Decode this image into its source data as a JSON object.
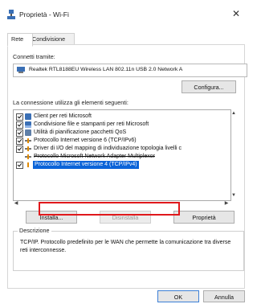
{
  "window": {
    "title": "Proprietà - Wi-Fi",
    "close_glyph": "✕"
  },
  "tabs": [
    {
      "label": "Rete",
      "active": true
    },
    {
      "label": "Condivisione",
      "active": false
    }
  ],
  "connect_label": "Connetti tramite:",
  "adapter": {
    "name": "Realtek RTL8188EU Wireless LAN 802.11n USB 2.0 Network A",
    "icon": "network-adapter-icon"
  },
  "configure_button": "Configura...",
  "items_label": "La connessione utilizza gli elementi seguenti:",
  "items": [
    {
      "label": "Client per reti Microsoft",
      "checked": true,
      "icon": "network-client-icon"
    },
    {
      "label": "Condivisione file e stampanti per reti Microsoft",
      "checked": true,
      "icon": "file-share-icon"
    },
    {
      "label": "Utilità di pianificazione pacchetti QoS",
      "checked": true,
      "icon": "qos-icon"
    },
    {
      "label": "Protocollo Internet versione 6 (TCP/IPv6)",
      "checked": true,
      "icon": "protocol-icon"
    },
    {
      "label": "Driver di I/O del mapping di individuazione topologia livelli c",
      "checked": true,
      "icon": "protocol-icon"
    },
    {
      "label": "Protocollo Microsoft Network Adapter Multiplexor",
      "checked": false,
      "icon": "protocol-icon"
    },
    {
      "label": "Protocollo Internet versione 4 (TCP/IPv4)",
      "checked": true,
      "icon": "protocol-icon",
      "selected": true
    }
  ],
  "buttons": {
    "install": "Installa...",
    "uninstall": "Disinstalla",
    "properties": "Proprietà"
  },
  "description": {
    "title": "Descrizione",
    "text": "TCP/IP. Protocollo predefinito per le WAN che permette la comunicazione tra diverse reti interconnesse."
  },
  "footer": {
    "ok": "OK",
    "cancel": "Annulla"
  },
  "colors": {
    "selection": "#0a63d8",
    "highlight_border": "#e0181c"
  }
}
